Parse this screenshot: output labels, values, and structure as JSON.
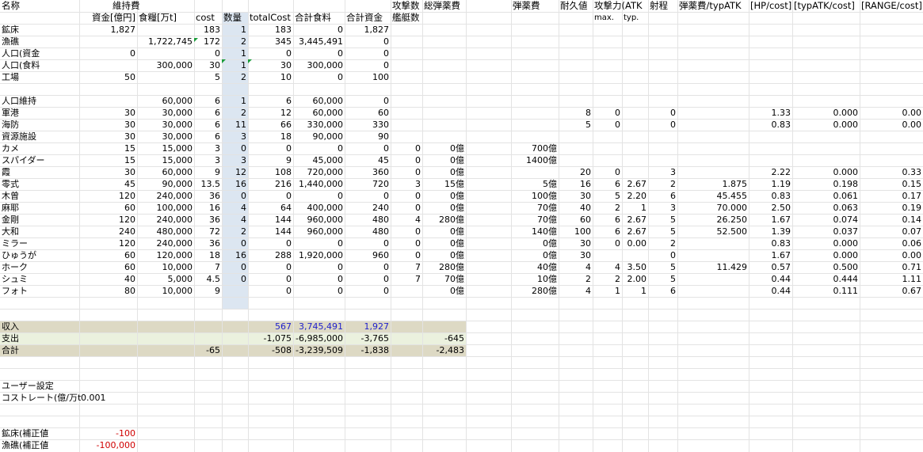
{
  "header": {
    "row1": {
      "name": "名称",
      "maint": "維持費",
      "atk_count": "攻撃数",
      "total_ammo": "総弾薬費",
      "ammo": "弾薬費",
      "dur": "耐久値",
      "atk": "攻撃力(ATK",
      "range": "射程",
      "ammo_per_atk": "弾薬費/typATK",
      "hp_cost": "[HP/cost]",
      "typatk_cost": "[typATK/cost]",
      "range_cost": "[RANGE/cost]"
    },
    "row2": {
      "fund": "資金[億円]",
      "food": "食糧[万t]",
      "cost": "cost",
      "qty": "数量",
      "total": "totalCost",
      "sum_food": "合計食料",
      "sum_fund": "合計資金",
      "ships": "艦艇数",
      "max": "max.",
      "typ": "typ."
    }
  },
  "rows": [
    [
      "鉱床",
      "1,827",
      "",
      "183",
      "1",
      "183",
      "0",
      "1,827",
      "",
      "",
      "",
      "",
      "",
      "",
      "",
      "",
      "",
      "",
      "",
      ""
    ],
    [
      "漁礁",
      "",
      "1,722,745",
      "172",
      "2",
      "345",
      "3,445,491",
      "0",
      "",
      "",
      "",
      "",
      "",
      "",
      "",
      "",
      "",
      "",
      "",
      ""
    ],
    [
      "人口(資金",
      "0",
      "",
      "0",
      "1",
      "0",
      "0",
      "0",
      "",
      "",
      "",
      "",
      "",
      "",
      "",
      "",
      "",
      "",
      "",
      ""
    ],
    [
      "人口(食料",
      "",
      "300,000",
      "30",
      "1",
      "30",
      "300,000",
      "0",
      "",
      "",
      "",
      "",
      "",
      "",
      "",
      "",
      "",
      "",
      "",
      ""
    ],
    [
      "工場",
      "50",
      "",
      "5",
      "2",
      "10",
      "0",
      "100",
      "",
      "",
      "",
      "",
      "",
      "",
      "",
      "",
      "",
      "",
      "",
      ""
    ],
    [
      "",
      "",
      "",
      "",
      "",
      "",
      "",
      "",
      "",
      "",
      "",
      "",
      "",
      "",
      "",
      "",
      "",
      "",
      "",
      ""
    ],
    [
      "人口維持",
      "",
      "60,000",
      "6",
      "1",
      "6",
      "60,000",
      "0",
      "",
      "",
      "",
      "",
      "",
      "",
      "",
      "",
      "",
      "",
      "",
      ""
    ],
    [
      "軍港",
      "30",
      "30,000",
      "6",
      "2",
      "12",
      "60,000",
      "60",
      "",
      "",
      "",
      "8",
      "0",
      "",
      "0",
      "",
      "1.33",
      "0.000",
      "0.00"
    ],
    [
      "海防",
      "30",
      "30,000",
      "6",
      "11",
      "66",
      "330,000",
      "330",
      "",
      "",
      "",
      "5",
      "0",
      "",
      "0",
      "",
      "0.83",
      "0.000",
      "0.00"
    ],
    [
      "資源施設",
      "30",
      "30,000",
      "6",
      "3",
      "18",
      "90,000",
      "90",
      "",
      "",
      "",
      "",
      "",
      "",
      "",
      "",
      "",
      "",
      ""
    ],
    [
      "カメ",
      "15",
      "15,000",
      "3",
      "0",
      "0",
      "0",
      "0",
      "0",
      "0億",
      "700億",
      "",
      "",
      "",
      "",
      "",
      "",
      "",
      ""
    ],
    [
      "スパイダー",
      "15",
      "15,000",
      "3",
      "3",
      "9",
      "45,000",
      "45",
      "0",
      "0億",
      "1400億",
      "",
      "",
      "",
      "",
      "",
      "",
      "",
      ""
    ],
    [
      "霞",
      "30",
      "60,000",
      "9",
      "12",
      "108",
      "720,000",
      "360",
      "0",
      "0億",
      "",
      "20",
      "0",
      "",
      "3",
      "",
      "2.22",
      "0.000",
      "0.33"
    ],
    [
      "零式",
      "45",
      "90,000",
      "13.5",
      "16",
      "216",
      "1,440,000",
      "720",
      "3",
      "15億",
      "5億",
      "16",
      "6",
      "2.67",
      "2",
      "1.875",
      "1.19",
      "0.198",
      "0.15"
    ],
    [
      "木曾",
      "120",
      "240,000",
      "36",
      "0",
      "0",
      "0",
      "0",
      "0",
      "0億",
      "100億",
      "30",
      "5",
      "2.20",
      "6",
      "45.455",
      "0.83",
      "0.061",
      "0.17"
    ],
    [
      "麻耶",
      "60",
      "100,000",
      "16",
      "4",
      "64",
      "400,000",
      "240",
      "0",
      "0億",
      "70億",
      "40",
      "2",
      "1",
      "3",
      "70.000",
      "2.50",
      "0.063",
      "0.19"
    ],
    [
      "金剛",
      "120",
      "240,000",
      "36",
      "4",
      "144",
      "960,000",
      "480",
      "4",
      "280億",
      "70億",
      "60",
      "6",
      "2.67",
      "5",
      "26.250",
      "1.67",
      "0.074",
      "0.14"
    ],
    [
      "大和",
      "240",
      "480,000",
      "72",
      "2",
      "144",
      "960,000",
      "480",
      "0",
      "0億",
      "140億",
      "100",
      "6",
      "2.67",
      "5",
      "52.500",
      "1.39",
      "0.037",
      "0.07"
    ],
    [
      "ミラー",
      "120",
      "240,000",
      "36",
      "0",
      "0",
      "0",
      "0",
      "0",
      "0億",
      "0億",
      "30",
      "0",
      "0.00",
      "2",
      "",
      "0.83",
      "0.000",
      "0.06"
    ],
    [
      "ひゅうが",
      "60",
      "120,000",
      "18",
      "16",
      "288",
      "1,920,000",
      "960",
      "0",
      "0億",
      "0億",
      "30",
      "",
      "",
      "0",
      "",
      "1.67",
      "0.000",
      "0.00"
    ],
    [
      "ホーク",
      "60",
      "10,000",
      "7",
      "0",
      "0",
      "0",
      "0",
      "7",
      "280億",
      "40億",
      "4",
      "4",
      "3.50",
      "5",
      "11.429",
      "0.57",
      "0.500",
      "0.71"
    ],
    [
      "シュミ",
      "40",
      "5,000",
      "4.5",
      "0",
      "0",
      "0",
      "0",
      "7",
      "70億",
      "10億",
      "2",
      "2",
      "2.00",
      "5",
      "",
      "0.44",
      "0.444",
      "1.11"
    ],
    [
      "フォト",
      "80",
      "10,000",
      "9",
      "",
      "0",
      "0",
      "0",
      "",
      "0億",
      "280億",
      "4",
      "1",
      "1",
      "6",
      "",
      "0.44",
      "0.111",
      "0.67"
    ]
  ],
  "summary": {
    "income": {
      "label": "収入",
      "total": "567",
      "food": "3,745,491",
      "fund": "1,927",
      "ammo": ""
    },
    "expense": {
      "label": "支出",
      "total": "-1,075",
      "food": "-6,985,000",
      "fund": "-3,765",
      "ammo": "-645"
    },
    "sum": {
      "label": "合計",
      "qty": "-65",
      "total": "-508",
      "food": "-3,239,509",
      "fund": "-1,838",
      "ammo": "-2,483"
    }
  },
  "user": {
    "title": "ユーザー設定",
    "rate_label": "コストレート(億/万t",
    "rate_value": "0.001",
    "adj1_label": "鉱床(補正値",
    "adj1_value": "-100",
    "adj2_label": "漁礁(補正値",
    "adj2_value": "-100,000"
  },
  "colors": {
    "band_tan": "#ddd9c4",
    "band_green": "#ebf1de",
    "qty_band": "#dce6f1",
    "blue_text": "#1f1fcc",
    "red_text": "#d00000"
  }
}
